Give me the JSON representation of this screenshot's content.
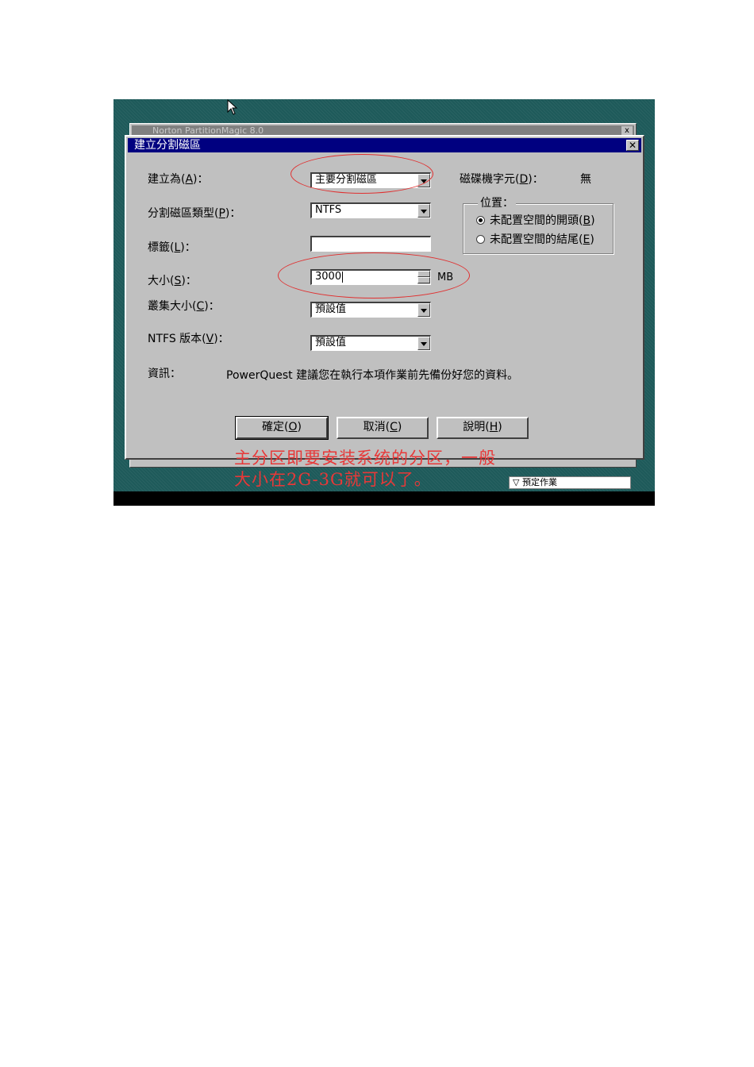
{
  "background_window": {
    "title": "Norton PartitionMagic 8.0",
    "close_glyph": "x",
    "footer_text": "▽ 預定作業"
  },
  "dialog": {
    "title": "建立分割磁區",
    "close_glyph": "✕",
    "create_as": {
      "label": "建立為(",
      "key": "A",
      "label_end": ")：",
      "value": "主要分割磁區"
    },
    "partition_type": {
      "label": "分割磁區類型(",
      "key": "P",
      "label_end": ")：",
      "value": "NTFS"
    },
    "label_field": {
      "label": "標籤(",
      "key": "L",
      "label_end": ")：",
      "value": ""
    },
    "size": {
      "label": "大小(",
      "key": "S",
      "label_end": ")：",
      "value": "3000",
      "unit": "MB"
    },
    "cluster_size": {
      "label": "叢集大小(",
      "key": "C",
      "label_end": ")：",
      "value": "預設值"
    },
    "ntfs_version": {
      "label": "NTFS 版本(",
      "key": "V",
      "label_end": ")：",
      "value": "預設值"
    },
    "drive_letter": {
      "label": "磁碟機字元(",
      "key": "D",
      "label_end": ")：",
      "value": "無"
    },
    "position": {
      "title": "位置：",
      "options": [
        {
          "label": "未配置空間的開頭(",
          "key": "B",
          "label_end": ")",
          "selected": true
        },
        {
          "label": "未配置空間的結尾(",
          "key": "E",
          "label_end": ")",
          "selected": false
        }
      ]
    },
    "info": {
      "label": "資訊：",
      "text": "PowerQuest 建議您在執行本項作業前先備份好您的資料。"
    },
    "buttons": {
      "ok": {
        "label": "確定(",
        "key": "O",
        "label_end": ")"
      },
      "cancel": {
        "label": "取消(",
        "key": "C",
        "label_end": ")"
      },
      "help": {
        "label": "說明(",
        "key": "H",
        "label_end": ")"
      }
    }
  },
  "annotation": {
    "line1": "主分区即要安装系统的分区，一般",
    "line2": "大小在2G-3G就可以了。",
    "color": "#e83838"
  },
  "colors": {
    "titlebar": "#000080",
    "dialog_face": "#c0c0c0",
    "desktop": "#1e5a5a"
  }
}
